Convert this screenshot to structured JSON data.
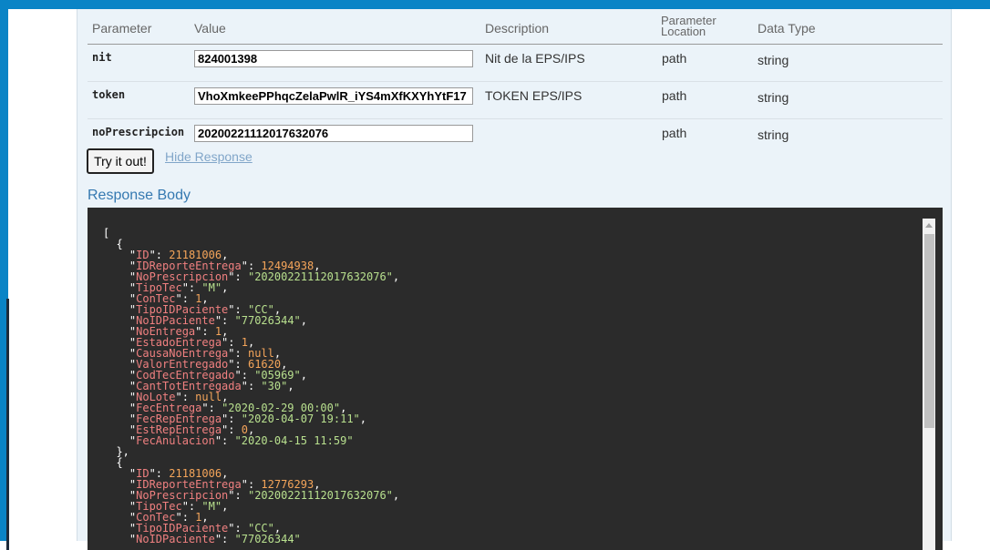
{
  "table": {
    "headers": {
      "parameter": "Parameter",
      "value": "Value",
      "description": "Description",
      "location_line1": "Parameter",
      "location_line2": "Location",
      "data_type": "Data Type"
    },
    "rows": [
      {
        "name": "nit",
        "value": "824001398",
        "description": "Nit de la EPS/IPS",
        "location": "path",
        "type": "string"
      },
      {
        "name": "token",
        "value": "VhoXmkeePPhqcZelaPwlR_iYS4mXfKXYhYtF17",
        "description": "TOKEN EPS/IPS",
        "location": "path",
        "type": "string"
      },
      {
        "name": "noPrescripcion",
        "value": "20200221112017632076",
        "description": "",
        "location": "path",
        "type": "string"
      }
    ]
  },
  "actions": {
    "try_label": "Try it out!",
    "hide_label": "Hide Response"
  },
  "response": {
    "title": "Response Body",
    "items": [
      {
        "ID": "21181006",
        "IDReporteEntrega": "12494938",
        "NoPrescripcion": "\"20200221112017632076\"",
        "TipoTec": "\"M\"",
        "ConTec": "1",
        "TipoIDPaciente": "\"CC\"",
        "NoIDPaciente": "\"77026344\"",
        "NoEntrega": "1",
        "EstadoEntrega": "1",
        "CausaNoEntrega": "null",
        "ValorEntregado": "61620",
        "CodTecEntregado": "\"05969\"",
        "CantTotEntregada": "\"30\"",
        "NoLote": "null",
        "FecEntrega": "\"2020-02-29 00:00\"",
        "FecRepEntrega": "\"2020-04-07 19:11\"",
        "EstRepEntrega": "0",
        "FecAnulacion": "\"2020-04-15 11:59\""
      },
      {
        "ID": "21181006",
        "IDReporteEntrega": "12776293",
        "NoPrescripcion": "\"20200221112017632076\"",
        "TipoTec": "\"M\"",
        "ConTec": "1",
        "TipoIDPaciente": "\"CC\"",
        "NoIDPaciente": "\"77026344\""
      }
    ]
  },
  "colors": {
    "topbar": "#0a84c6",
    "panel": "#ebf3f9",
    "code_bg": "#2b2b2b",
    "json_key": "#f08080",
    "json_string": "#b8e08e",
    "json_number": "#f5a55a",
    "link": "#81a6c9",
    "section_title": "#3579b1"
  }
}
